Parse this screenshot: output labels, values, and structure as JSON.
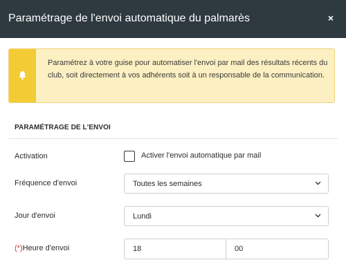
{
  "dialog": {
    "title": "Paramétrage de l'envoi automatique du palmarès",
    "close_label": "×"
  },
  "alert": {
    "icon": "bell-icon",
    "message": "Paramétrez à votre guise pour automatiser l'envoi par mail des résultats récents du club, soit directement à vos adhérents soit à un responsable de la communication.",
    "colors": {
      "background": "#fcf0c3",
      "icon_background": "#f3cc35"
    }
  },
  "section": {
    "title": "PARAMÉTRAGE DE L'ENVOI"
  },
  "form": {
    "activation": {
      "label": "Activation",
      "checkbox_label": "Activer l'envoi automatique par mail",
      "checked": false
    },
    "frequency": {
      "label": "Fréquence d'envoi",
      "value": "Toutes les semaines"
    },
    "day": {
      "label": "Jour d'envoi",
      "value": "Lundi"
    },
    "time": {
      "required_marker": "(*)",
      "label": "Heure d'envoi",
      "hour": "18",
      "minute": "00"
    }
  },
  "colors": {
    "header": "#2e3940",
    "required": "#d9322e"
  }
}
